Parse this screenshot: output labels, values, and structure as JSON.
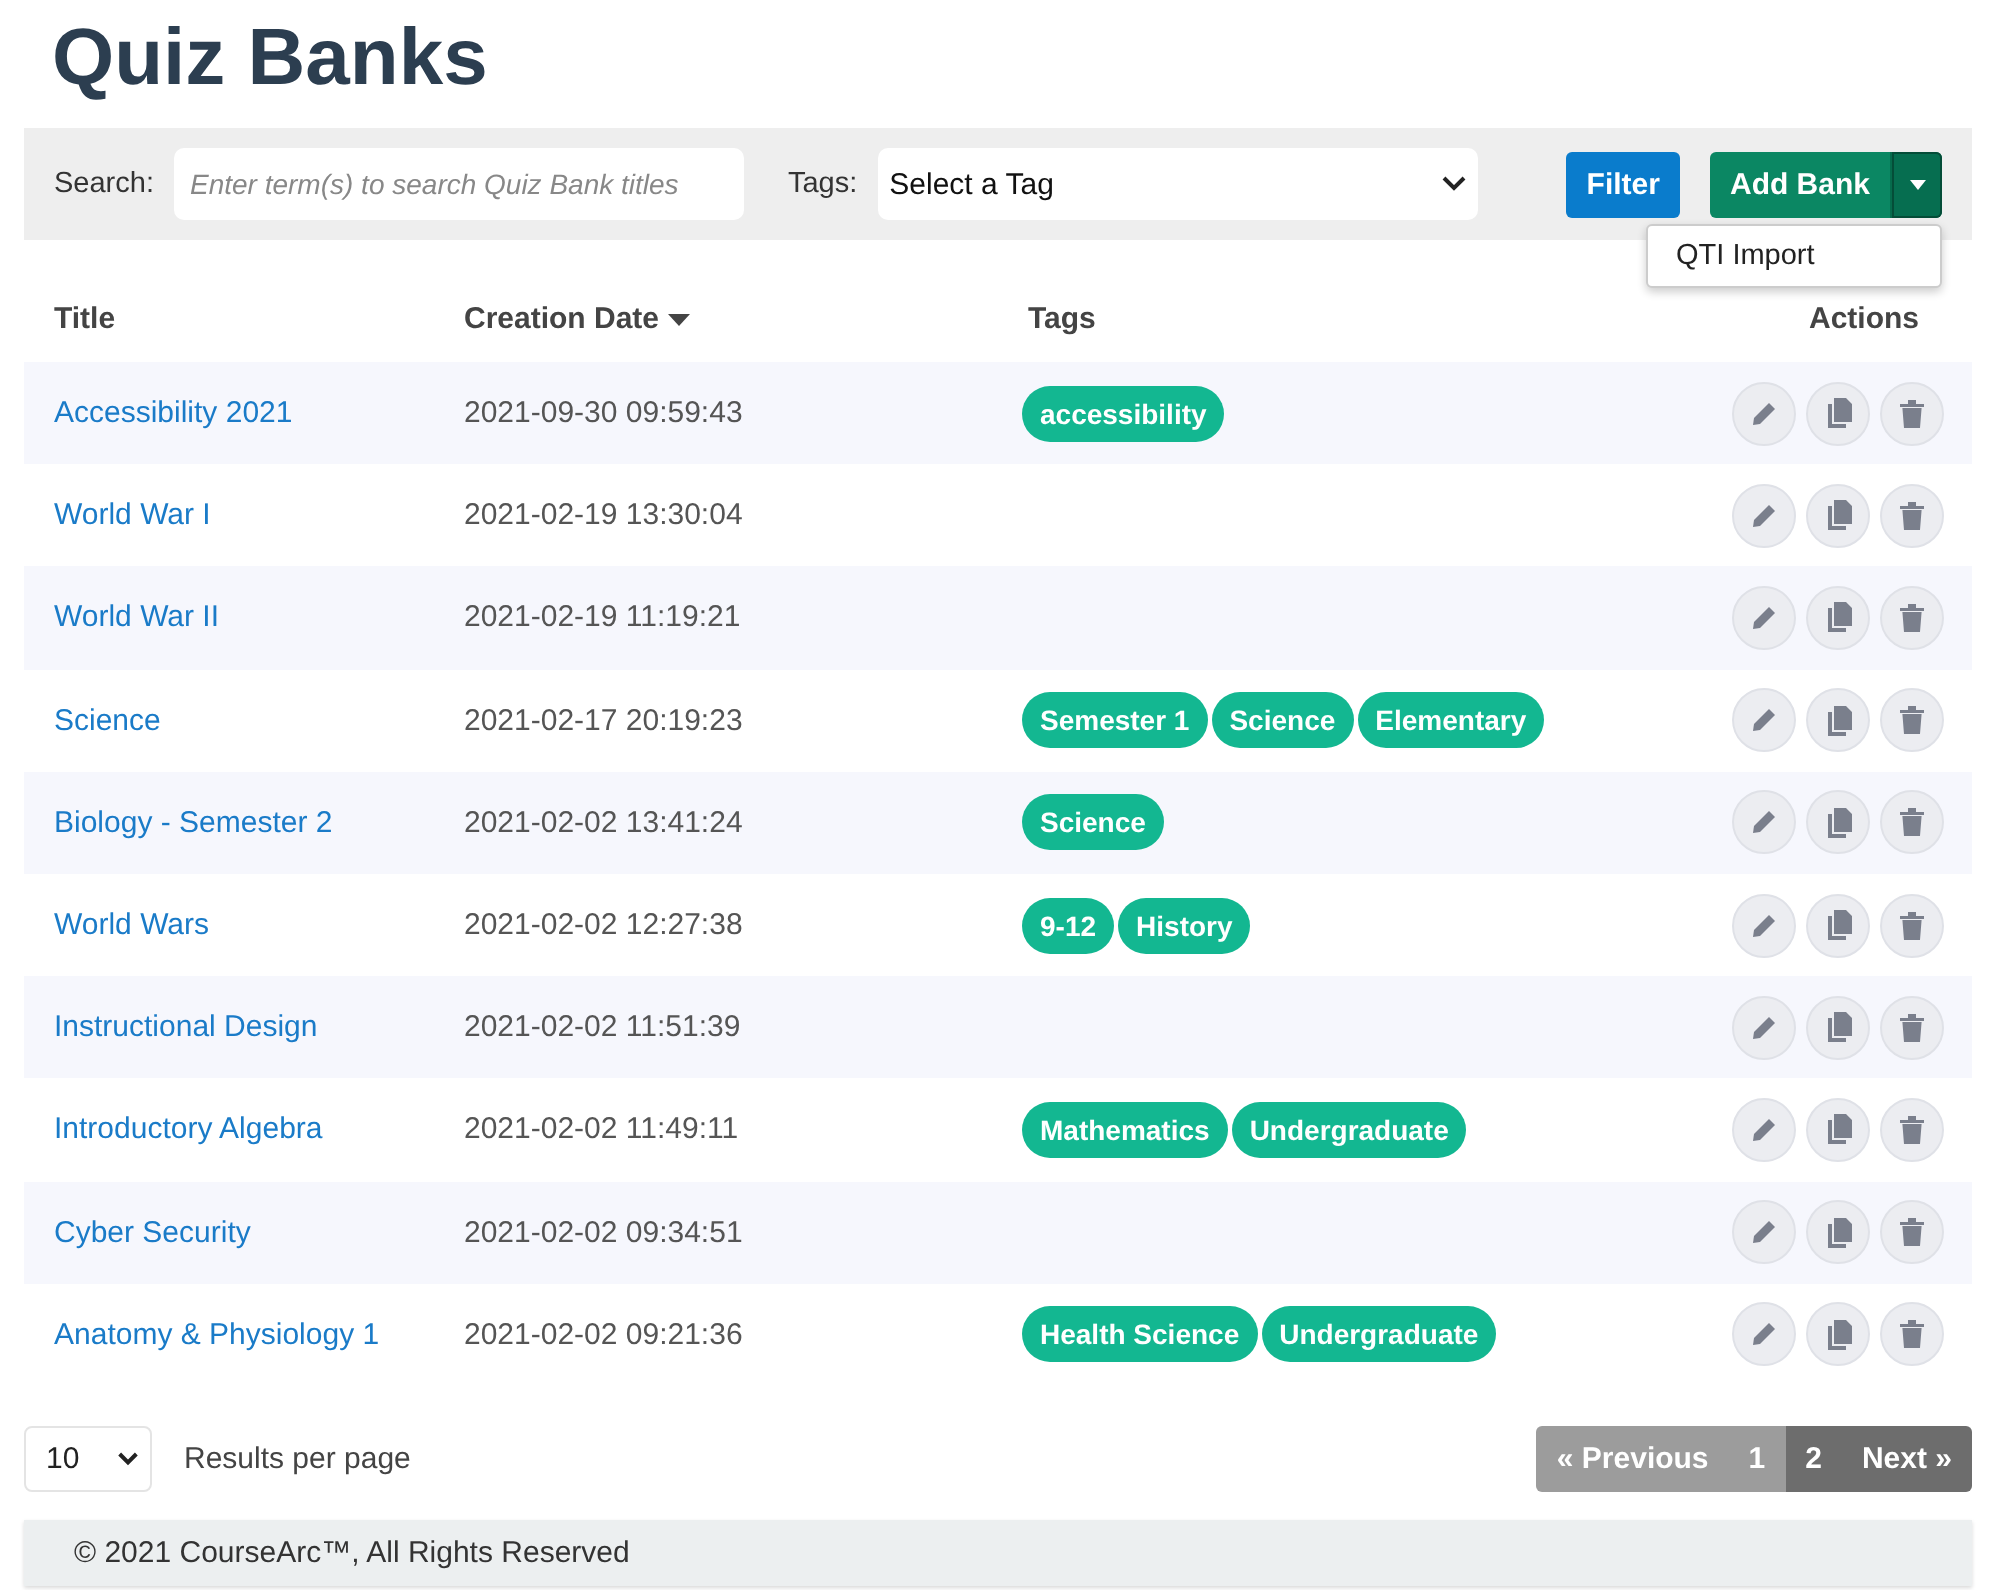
{
  "page_title": "Quiz Banks",
  "toolbar": {
    "search_label": "Search:",
    "search": {
      "placeholder": "Enter term(s) to search Quiz Bank titles"
    },
    "tags_label": "Tags:",
    "tags_select": {
      "value": "Select a Tag"
    },
    "filter_button": "Filter",
    "add_button": "Add Bank",
    "add_menu": {
      "expanded": true,
      "items": [
        "QTI Import"
      ]
    }
  },
  "table": {
    "columns": [
      {
        "label": "Title",
        "sorted": false
      },
      {
        "label": "Creation Date",
        "sorted": true
      },
      {
        "label": "Tags",
        "sorted": false
      },
      {
        "label": "Actions",
        "sorted": false
      }
    ],
    "rows": [
      {
        "title": "Accessibility 2021",
        "date": "2021-09-30 09:59:43",
        "tags": [
          "accessibility"
        ]
      },
      {
        "title": "World War I",
        "date": "2021-02-19 13:30:04",
        "tags": []
      },
      {
        "title": "World War II",
        "date": "2021-02-19 11:19:21",
        "tags": []
      },
      {
        "title": "Science",
        "date": "2021-02-17 20:19:23",
        "tags": [
          "Semester 1",
          "Science",
          "Elementary"
        ]
      },
      {
        "title": "Biology - Semester 2",
        "date": "2021-02-02 13:41:24",
        "tags": [
          "Science"
        ]
      },
      {
        "title": "World Wars",
        "date": "2021-02-02 12:27:38",
        "tags": [
          "9-12",
          "History"
        ]
      },
      {
        "title": "Instructional Design",
        "date": "2021-02-02 11:51:39",
        "tags": []
      },
      {
        "title": "Introductory Algebra",
        "date": "2021-02-02 11:49:11",
        "tags": [
          "Mathematics",
          "Undergraduate"
        ]
      },
      {
        "title": "Cyber Security",
        "date": "2021-02-02 09:34:51",
        "tags": []
      },
      {
        "title": "Anatomy & Physiology 1",
        "date": "2021-02-02 09:21:36",
        "tags": [
          "Health Science",
          "Undergraduate"
        ]
      }
    ]
  },
  "pager": {
    "per_page": {
      "value": "10"
    },
    "per_page_label": "Results per page",
    "previous": {
      "label": "« Previous",
      "disabled": true
    },
    "pages": [
      {
        "label": "1",
        "selected": true
      },
      {
        "label": "2",
        "selected": false
      }
    ],
    "next": {
      "label": "Next »",
      "disabled": false
    }
  },
  "footer": "© 2021 CourseArc™, All Rights Reserved"
}
